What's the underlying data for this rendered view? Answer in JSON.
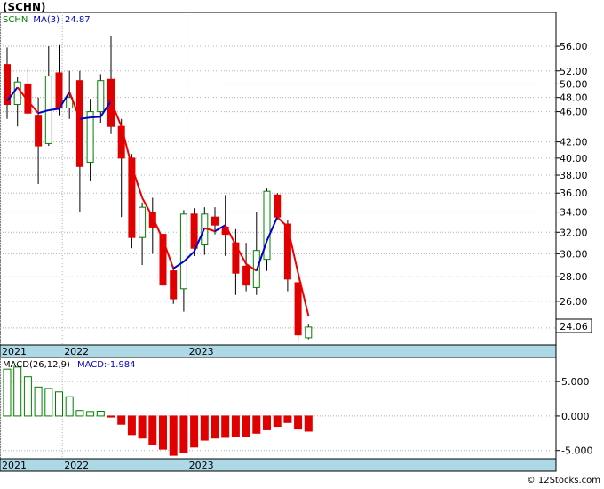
{
  "title": "(SCHN)",
  "price_legend": {
    "symbol": "SCHN",
    "ma_label": "MA(3)",
    "ma_value": "24.87"
  },
  "macd_legend": {
    "label": "MACD(26,12,9)",
    "value_label": "MACD:-1.984"
  },
  "last_price_label": "24.06",
  "watermark": "© 12Stocks.com",
  "colors": {
    "up": "#008000",
    "down": "#e00000",
    "ma_rising": "#0000cc",
    "ma_falling": "#ee0000",
    "axis_band": "#add8e6",
    "grid": "#b0b0b0"
  },
  "chart_data": [
    {
      "type": "candlestick",
      "title": "(SCHN)",
      "x_tick_labels": [
        {
          "label": "2021",
          "index": 0
        },
        {
          "label": "2022",
          "index": 6
        },
        {
          "label": "2023",
          "index": 18
        }
      ],
      "y_tick_labels": [
        "56.00",
        "52.00",
        "50.00",
        "48.00",
        "46.00",
        "42.00",
        "40.00",
        "38.00",
        "36.00",
        "34.00",
        "32.00",
        "30.00",
        "28.00",
        "26.00",
        "24.00"
      ],
      "y_scale": "log",
      "ylim": [
        22.8,
        62.0
      ],
      "candles": [
        {
          "o": 53.0,
          "h": 55.8,
          "l": 45.0,
          "c": 47.0
        },
        {
          "o": 47.0,
          "h": 51.0,
          "l": 44.0,
          "c": 50.3
        },
        {
          "o": 50.0,
          "h": 52.5,
          "l": 45.5,
          "c": 45.8
        },
        {
          "o": 45.5,
          "h": 48.0,
          "l": 37.0,
          "c": 41.5
        },
        {
          "o": 41.8,
          "h": 56.0,
          "l": 41.5,
          "c": 51.2
        },
        {
          "o": 51.7,
          "h": 56.2,
          "l": 45.5,
          "c": 46.5
        },
        {
          "o": 46.5,
          "h": 52.0,
          "l": 45.0,
          "c": 48.0
        },
        {
          "o": 50.5,
          "h": 52.0,
          "l": 34.0,
          "c": 39.0
        },
        {
          "o": 39.5,
          "h": 47.8,
          "l": 37.3,
          "c": 46.0
        },
        {
          "o": 46.0,
          "h": 51.5,
          "l": 44.5,
          "c": 50.5
        },
        {
          "o": 50.7,
          "h": 57.8,
          "l": 43.0,
          "c": 44.0
        },
        {
          "o": 44.0,
          "h": 45.0,
          "l": 33.5,
          "c": 40.0
        },
        {
          "o": 40.0,
          "h": 40.5,
          "l": 30.5,
          "c": 31.5
        },
        {
          "o": 31.5,
          "h": 35.0,
          "l": 29.0,
          "c": 34.5
        },
        {
          "o": 34.0,
          "h": 35.5,
          "l": 30.0,
          "c": 32.5
        },
        {
          "o": 31.8,
          "h": 32.3,
          "l": 26.8,
          "c": 27.3
        },
        {
          "o": 28.5,
          "h": 28.9,
          "l": 25.8,
          "c": 26.2
        },
        {
          "o": 27.0,
          "h": 34.2,
          "l": 25.2,
          "c": 33.8
        },
        {
          "o": 33.8,
          "h": 34.4,
          "l": 29.8,
          "c": 30.5
        },
        {
          "o": 30.8,
          "h": 34.5,
          "l": 29.9,
          "c": 33.8
        },
        {
          "o": 33.5,
          "h": 34.5,
          "l": 31.8,
          "c": 32.7
        },
        {
          "o": 32.5,
          "h": 35.8,
          "l": 29.8,
          "c": 31.8
        },
        {
          "o": 31.0,
          "h": 32.3,
          "l": 26.5,
          "c": 28.3
        },
        {
          "o": 28.9,
          "h": 31.0,
          "l": 26.8,
          "c": 27.3
        },
        {
          "o": 27.1,
          "h": 34.0,
          "l": 26.5,
          "c": 30.3
        },
        {
          "o": 29.5,
          "h": 36.5,
          "l": 28.5,
          "c": 36.2
        },
        {
          "o": 35.8,
          "h": 36.0,
          "l": 33.2,
          "c": 33.5
        },
        {
          "o": 32.8,
          "h": 33.2,
          "l": 26.8,
          "c": 27.8
        },
        {
          "o": 27.5,
          "h": 27.8,
          "l": 23.1,
          "c": 23.5
        },
        {
          "o": 23.3,
          "h": 24.3,
          "l": 23.2,
          "c": 24.06
        }
      ],
      "ma_series": {
        "name": "MA(3)",
        "start_index": 0,
        "values": [
          47.5,
          49.5,
          47.5,
          45.8,
          46.2,
          46.4,
          48.8,
          45.0,
          45.2,
          45.3,
          47.5,
          44.0,
          39.0,
          35.5,
          33.5,
          31.3,
          28.7,
          29.3,
          30.2,
          32.4,
          32.1,
          32.7,
          30.8,
          29.1,
          28.5,
          31.2,
          33.5,
          32.5,
          28.3,
          24.9
        ]
      }
    },
    {
      "type": "bar",
      "title": "MACD(26,12,9)",
      "x_tick_labels": [
        {
          "label": "2021",
          "index": 0
        },
        {
          "label": "2022",
          "index": 6
        },
        {
          "label": "2023",
          "index": 18
        }
      ],
      "y_tick_labels": [
        "5.000",
        "0.000",
        "-5.000"
      ],
      "ylim": [
        -6.2,
        8.5
      ],
      "values": [
        6.8,
        7.1,
        5.7,
        4.2,
        4.0,
        3.5,
        2.8,
        0.8,
        0.65,
        0.7,
        -0.15,
        -1.2,
        -2.7,
        -3.2,
        -4.2,
        -4.8,
        -5.7,
        -5.3,
        -4.5,
        -3.5,
        -3.2,
        -3.1,
        -3.0,
        -3.0,
        -2.5,
        -2.0,
        -1.5,
        -0.95,
        -1.9,
        -2.2
      ]
    }
  ]
}
